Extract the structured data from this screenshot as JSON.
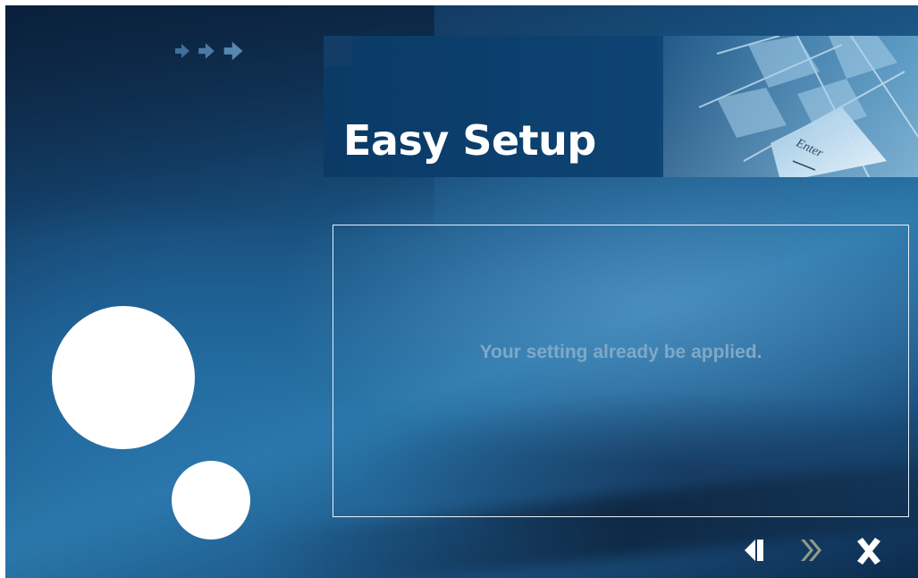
{
  "header": {
    "title": "Easy Setup",
    "key_label": "Enter"
  },
  "panel": {
    "message": "Your setting already be applied."
  },
  "icons": {
    "decor_arrows": [
      "arrow-right-icon",
      "arrow-right-icon",
      "arrow-right-icon"
    ],
    "back": "double-chevron-left-icon",
    "next": "double-chevron-right-icon",
    "close": "close-x-icon"
  },
  "colors": {
    "banner": "#0b3a66",
    "message_text": "#7fa9c8",
    "next_disabled": "#8e9b86",
    "icon_white": "#ffffff"
  },
  "nav": {
    "next_enabled": false
  }
}
